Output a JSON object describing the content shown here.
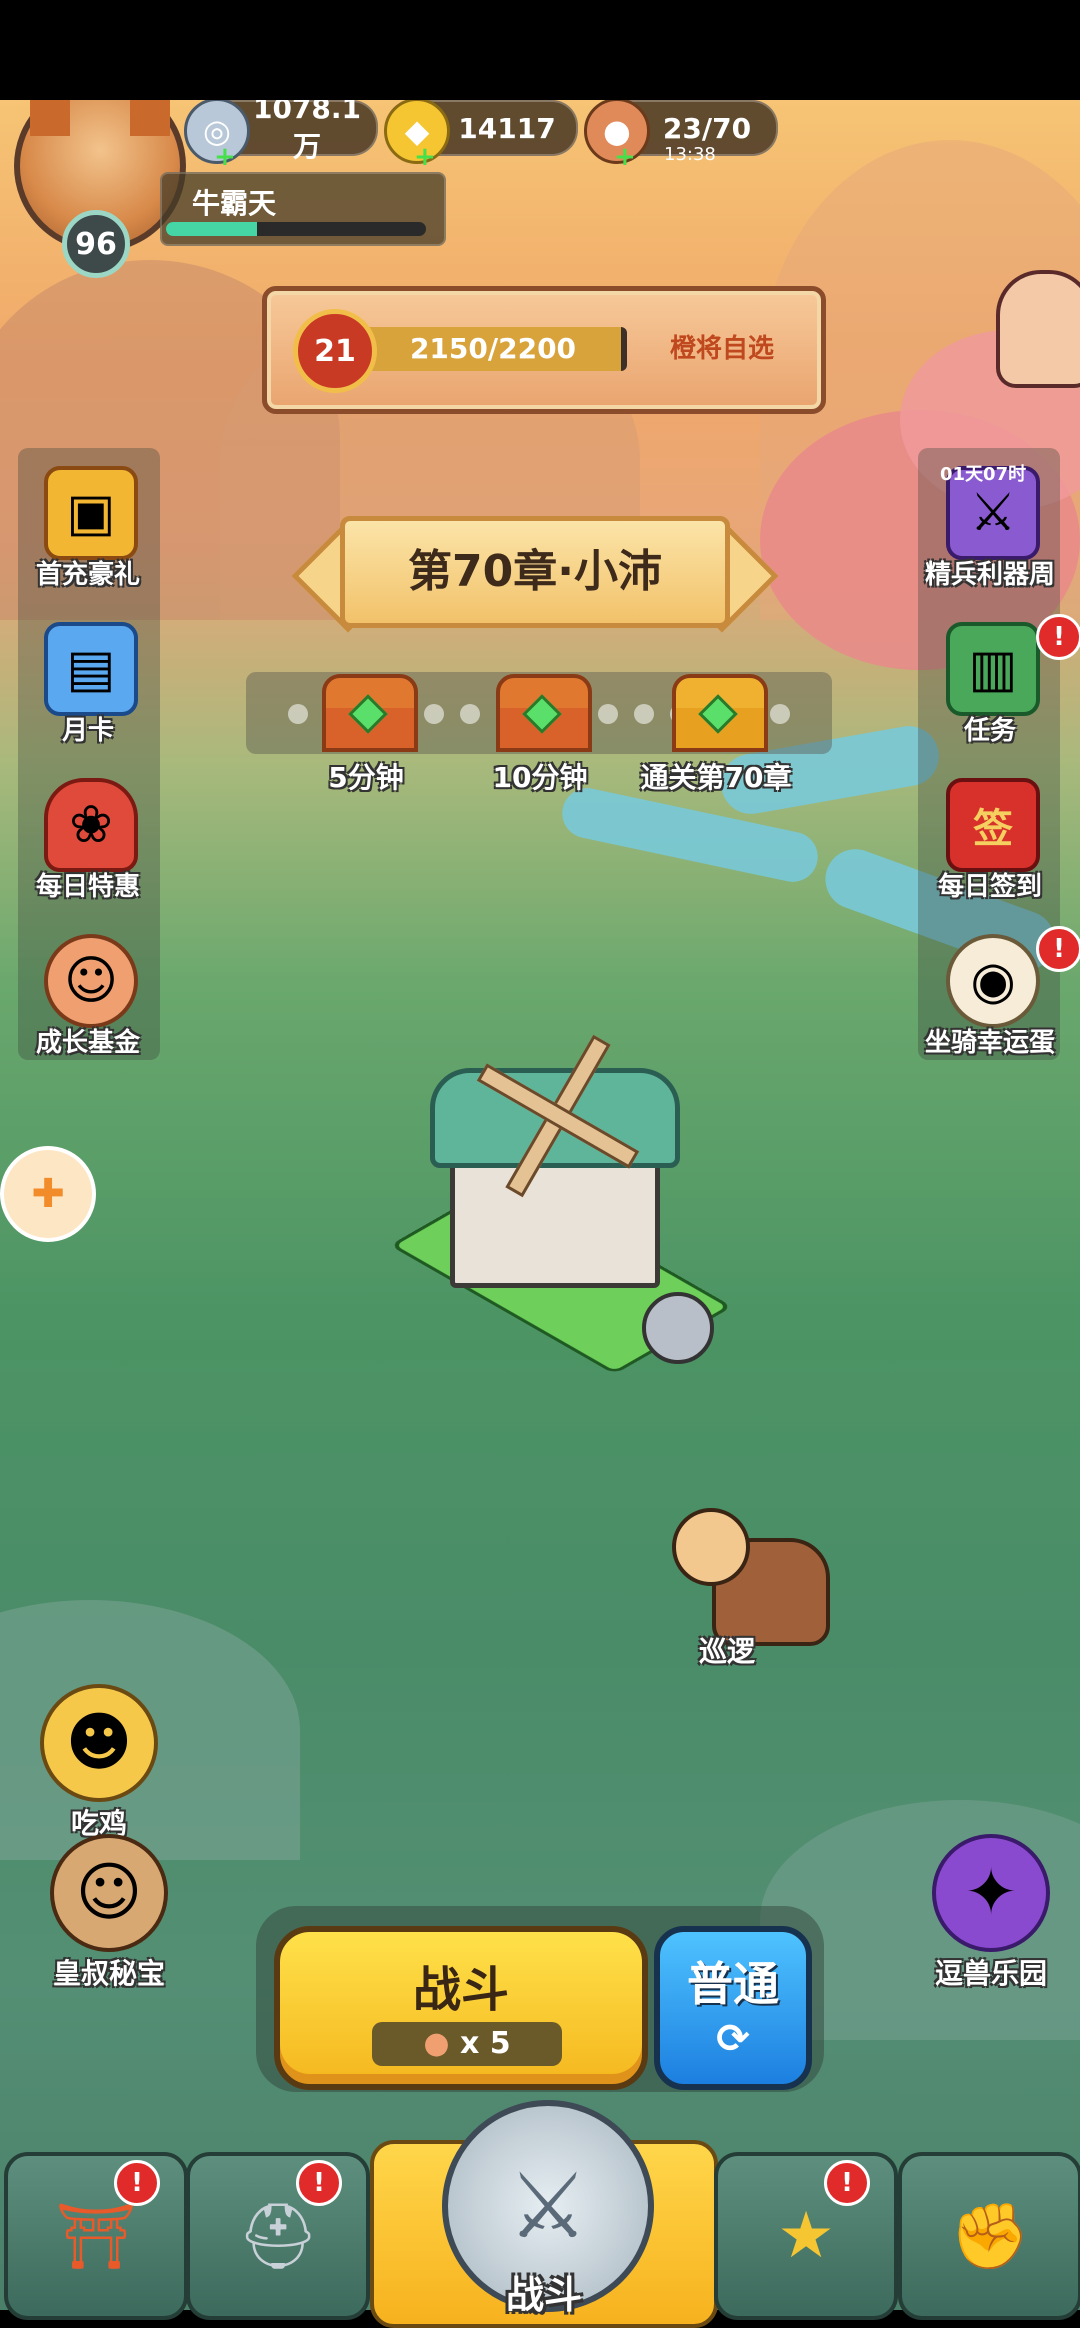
{
  "player": {
    "name": "牛霸天",
    "level": "96",
    "xp_fraction": 0.35
  },
  "resources": {
    "silver": "1078.1万",
    "gold": "14117",
    "stamina": "23/70",
    "stamina_timer": "13:38"
  },
  "progress_panel": {
    "rank": "21",
    "value": "2150/2200",
    "fraction": 0.977,
    "button": "橙将自选"
  },
  "left_menu": [
    {
      "label": "首充豪礼",
      "icon": "treasure-chest-icon"
    },
    {
      "label": "月卡",
      "icon": "calendar-card-icon"
    },
    {
      "label": "每日特惠",
      "icon": "gift-bag-icon"
    },
    {
      "label": "成长基金",
      "icon": "fund-character-icon"
    }
  ],
  "right_menu": [
    {
      "label": "精兵利器周",
      "icon": "weapons-icon",
      "timer": "01天07时"
    },
    {
      "label": "任务",
      "icon": "scroll-icon",
      "badge": "!"
    },
    {
      "label": "每日签到",
      "icon": "sign-in-icon",
      "stamp": "签"
    },
    {
      "label": "坐骑幸运蛋",
      "icon": "lucky-egg-icon",
      "badge": "!"
    }
  ],
  "chapter": {
    "title": "第70章·小沛"
  },
  "chests": [
    {
      "label": "5分钟"
    },
    {
      "label": "10分钟"
    },
    {
      "label": "通关第70章"
    }
  ],
  "patrol": {
    "label": "巡逻"
  },
  "floating": {
    "chicken": "吃鸡",
    "uncle_treasure": "皇叔秘宝",
    "beast_park": "逗兽乐园"
  },
  "battle": {
    "fight_label": "战斗",
    "cost": "x 5",
    "mode_label": "普通"
  },
  "bottom_nav": {
    "main_label": "战斗",
    "badge": "!"
  },
  "colors": {
    "accent": "#f5b71e",
    "alert": "#e12a2a",
    "mode_blue": "#1c7fe0"
  }
}
